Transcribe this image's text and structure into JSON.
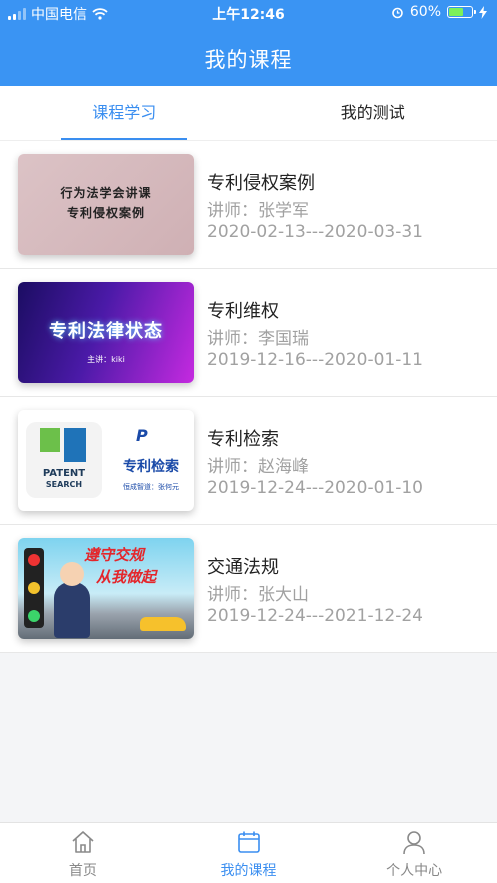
{
  "status_bar": {
    "carrier": "中国电信",
    "time": "上午12:46",
    "battery": "60%",
    "battery_level": 0.6
  },
  "header": {
    "title": "我的课程"
  },
  "tabs": [
    {
      "label": "课程学习",
      "active": true
    },
    {
      "label": "我的测试",
      "active": false
    }
  ],
  "courses": [
    {
      "name": "专利侵权案例",
      "teacher": "讲师：张学军",
      "dates": "2020-02-13---2020-03-31",
      "thumb": {
        "line1": "行为法学会讲课",
        "line2": "专利侵权案例"
      }
    },
    {
      "name": "专利维权",
      "teacher": "讲师：李国瑞",
      "dates": "2019-12-16---2020-01-11",
      "thumb": {
        "title": "专利法律状态",
        "speaker": "主讲：kiki"
      }
    },
    {
      "name": "专利检索",
      "teacher": "讲师：赵海峰",
      "dates": "2019-12-24---2020-01-10",
      "thumb": {
        "logo_line1": "PATENT",
        "logo_line2": "SEARCH",
        "title": "专利检索",
        "sub": "恒成智道：张何元",
        "mark": "P"
      }
    },
    {
      "name": "交通法规",
      "teacher": "讲师：张大山",
      "dates": "2019-12-24---2021-12-24",
      "thumb": {
        "line1": "遵守交规",
        "line2": "从我做起"
      }
    }
  ],
  "tabbar": [
    {
      "label": "首页",
      "icon": "home-icon",
      "active": false
    },
    {
      "label": "我的课程",
      "icon": "calendar-icon",
      "active": true
    },
    {
      "label": "个人中心",
      "icon": "person-icon",
      "active": false
    }
  ],
  "colors": {
    "primary": "#3a94f3",
    "active_tab": "#3a8ef0",
    "muted_text": "#a1a1a1"
  }
}
